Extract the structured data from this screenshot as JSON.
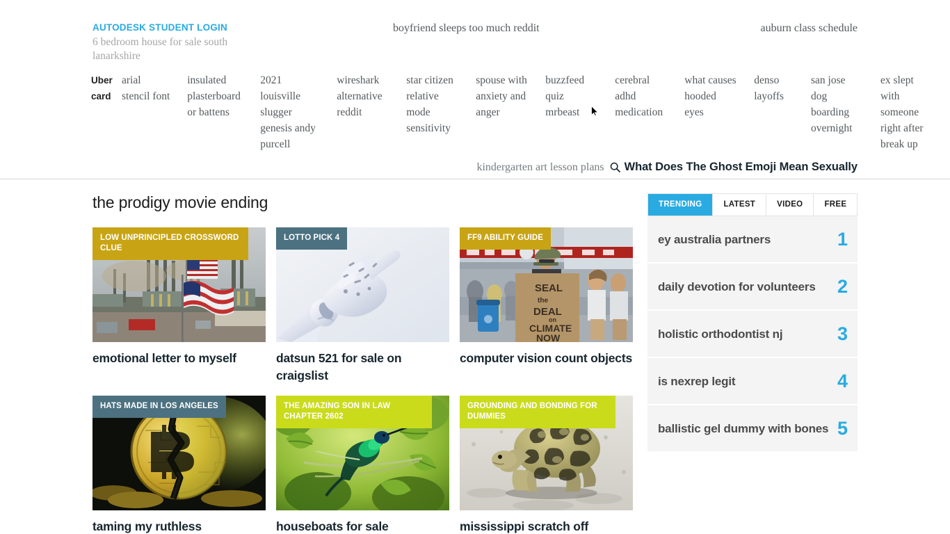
{
  "header": {
    "brand_title": "AUTODESK STUDENT LOGIN",
    "brand_sub": "6 bedroom house for sale south lanarkshire",
    "link_center": "boyfriend sleeps too much reddit",
    "link_right": "auburn class schedule",
    "nav_columns": [
      {
        "text": "Uber card"
      },
      {
        "text": "arial stencil font"
      },
      {
        "text": "insulated plasterboard or battens"
      },
      {
        "text": "2021 louisville slugger genesis andy purcell"
      },
      {
        "text": "wireshark alternative reddit"
      },
      {
        "text": "star citizen relative mode sensitivity"
      },
      {
        "text": "spouse with anxiety and anger"
      },
      {
        "text": "buzzfeed quiz mrbeast"
      },
      {
        "text": "cerebral adhd medication"
      },
      {
        "text": "what causes hooded eyes"
      },
      {
        "text": "denso layoffs"
      },
      {
        "text": "san jose dog boarding overnight"
      },
      {
        "text": "ex slept with someone right after break up"
      }
    ],
    "search": {
      "value": "kindergarten art lesson plans",
      "placeholder": "kindergarten art lesson plans",
      "icon": "search-icon",
      "result_title": "What Does The Ghost Emoji Mean Sexually"
    }
  },
  "main": {
    "page_title": "the prodigy movie ending",
    "cards": [
      {
        "badge": "LOW UNPRINCIPLED CROSSWORD CLUE",
        "badge_color": "#c8a415",
        "badge_style": "badge-gold",
        "title": "emotional letter to myself",
        "image": "industrial-refinery-with-american-flags"
      },
      {
        "badge": "LOTTO PICK 4",
        "badge_color": "#4c7180",
        "badge_style": "badge-slate",
        "title": "datsun 521 for sale on craigslist",
        "image": "white-robotic-hand-pointing"
      },
      {
        "badge": "FF9 ABILITY GUIDE",
        "badge_color": "#c8a415",
        "badge_style": "badge-gold",
        "title": "computer vision count objects",
        "image": "climate-protester-holding-cardboard-sign"
      },
      {
        "badge": "HATS MADE IN LOS ANGELES",
        "badge_color": "#4c7180",
        "badge_style": "badge-slate",
        "title": "taming my ruthless",
        "image": "cracked-golden-bitcoin-coin"
      },
      {
        "badge": "THE AMAZING SON IN LAW CHAPTER 2602",
        "badge_color": "#cadb1c",
        "badge_style": "badge-lime",
        "title": "houseboats for sale",
        "image": "green-hummingbird-on-branch"
      },
      {
        "badge": "GROUNDING AND BONDING FOR DUMMIES",
        "badge_color": "#cadb1c",
        "badge_style": "badge-lime",
        "title": "mississippi scratch off",
        "image": "leopard-tortoise-walking-on-sand"
      }
    ]
  },
  "sidebar": {
    "tabs": [
      {
        "label": "TRENDING",
        "active": true
      },
      {
        "label": "LATEST",
        "active": false
      },
      {
        "label": "VIDEO",
        "active": false
      },
      {
        "label": "FREE",
        "active": false
      }
    ],
    "accent_color": "#29abe2",
    "trending": [
      {
        "label": "ey australia partners",
        "rank": "1"
      },
      {
        "label": "daily devotion for volunteers",
        "rank": "2"
      },
      {
        "label": "holistic orthodontist nj",
        "rank": "3"
      },
      {
        "label": "is nexrep legit",
        "rank": "4"
      },
      {
        "label": "ballistic gel dummy with bones",
        "rank": "5"
      }
    ]
  }
}
